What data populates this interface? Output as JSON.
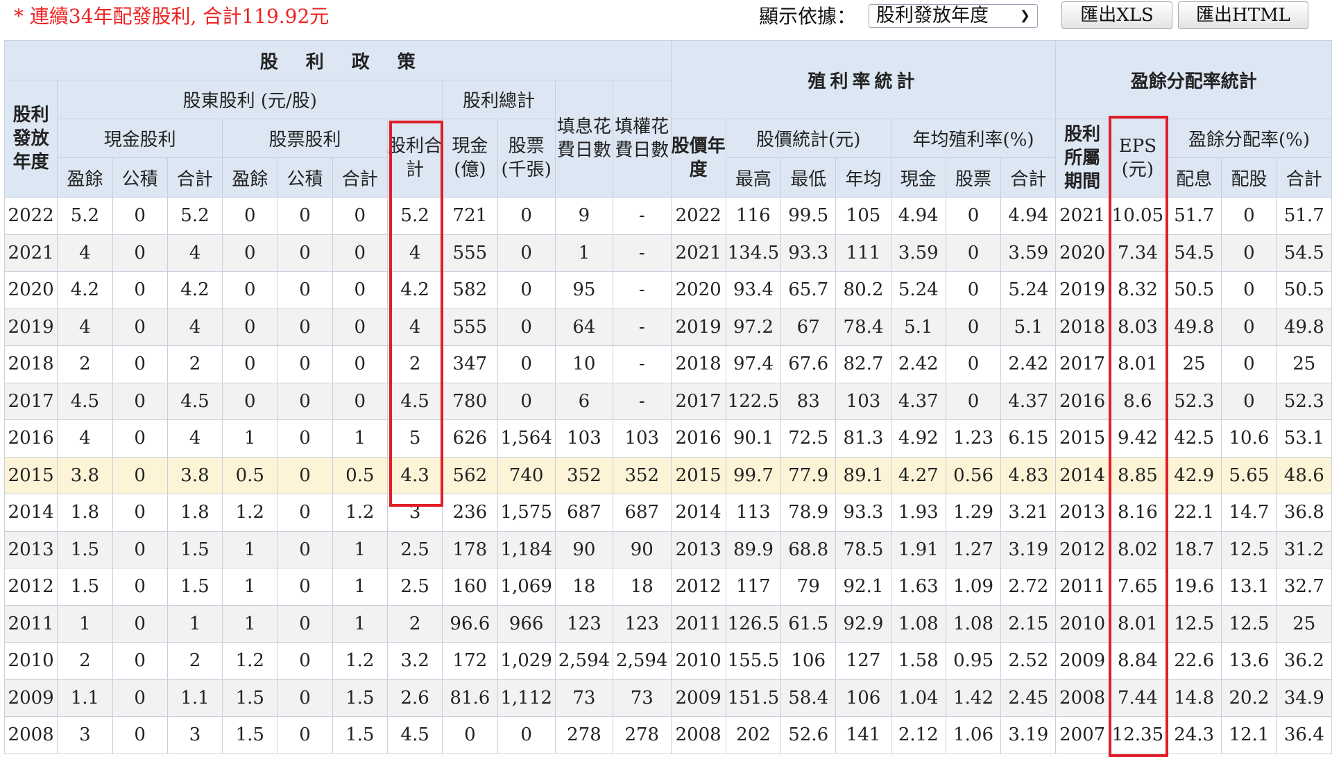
{
  "topbar": {
    "note": "* 連續34年配發股利, 合計119.92元",
    "display_label": "顯示依據：",
    "display_select": "股利發放年度",
    "export_xls": "匯出XLS",
    "export_html": "匯出HTML"
  },
  "header": {
    "policy": "股利政策",
    "yield_stats": "殖利率統計",
    "payout_stats": "盈餘分配率統計",
    "dividend_year": "股利發放年度",
    "shareholder_dividend": "股東股利 (元/股)",
    "dividend_total_group": "股利總計",
    "ex_div_days": "填息花費日數",
    "ex_right_days": "填權花費日數",
    "cash_dividend": "現金股利",
    "stock_dividend": "股票股利",
    "dividend_sum": "股利合計",
    "cash_total": "現金(億)",
    "stock_total": "股票(千張)",
    "earnings": "盈餘",
    "reserve": "公積",
    "subtotal": "合計",
    "price_year": "股價年度",
    "price_stats": "股價統計(元)",
    "avg_yield": "年均殖利率(%)",
    "high": "最高",
    "low": "最低",
    "avg": "年均",
    "cash": "現金",
    "stock": "股票",
    "period": "股利所屬期間",
    "eps": "EPS (元)",
    "payout_ratio": "盈餘分配率(%)",
    "payout_cash": "配息",
    "payout_stock": "配股"
  },
  "rows": [
    [
      "2022",
      "5.2",
      "0",
      "5.2",
      "0",
      "0",
      "0",
      "5.2",
      "721",
      "0",
      "9",
      "-",
      "2022",
      "116",
      "99.5",
      "105",
      "4.94",
      "0",
      "4.94",
      "2021",
      "10.05",
      "51.7",
      "0",
      "51.7"
    ],
    [
      "2021",
      "4",
      "0",
      "4",
      "0",
      "0",
      "0",
      "4",
      "555",
      "0",
      "1",
      "-",
      "2021",
      "134.5",
      "93.3",
      "111",
      "3.59",
      "0",
      "3.59",
      "2020",
      "7.34",
      "54.5",
      "0",
      "54.5"
    ],
    [
      "2020",
      "4.2",
      "0",
      "4.2",
      "0",
      "0",
      "0",
      "4.2",
      "582",
      "0",
      "95",
      "-",
      "2020",
      "93.4",
      "65.7",
      "80.2",
      "5.24",
      "0",
      "5.24",
      "2019",
      "8.32",
      "50.5",
      "0",
      "50.5"
    ],
    [
      "2019",
      "4",
      "0",
      "4",
      "0",
      "0",
      "0",
      "4",
      "555",
      "0",
      "64",
      "-",
      "2019",
      "97.2",
      "67",
      "78.4",
      "5.1",
      "0",
      "5.1",
      "2018",
      "8.03",
      "49.8",
      "0",
      "49.8"
    ],
    [
      "2018",
      "2",
      "0",
      "2",
      "0",
      "0",
      "0",
      "2",
      "347",
      "0",
      "10",
      "-",
      "2018",
      "97.4",
      "67.6",
      "82.7",
      "2.42",
      "0",
      "2.42",
      "2017",
      "8.01",
      "25",
      "0",
      "25"
    ],
    [
      "2017",
      "4.5",
      "0",
      "4.5",
      "0",
      "0",
      "0",
      "4.5",
      "780",
      "0",
      "6",
      "-",
      "2017",
      "122.5",
      "83",
      "103",
      "4.37",
      "0",
      "4.37",
      "2016",
      "8.6",
      "52.3",
      "0",
      "52.3"
    ],
    [
      "2016",
      "4",
      "0",
      "4",
      "1",
      "0",
      "1",
      "5",
      "626",
      "1,564",
      "103",
      "103",
      "2016",
      "90.1",
      "72.5",
      "81.3",
      "4.92",
      "1.23",
      "6.15",
      "2015",
      "9.42",
      "42.5",
      "10.6",
      "53.1"
    ],
    [
      "2015",
      "3.8",
      "0",
      "3.8",
      "0.5",
      "0",
      "0.5",
      "4.3",
      "562",
      "740",
      "352",
      "352",
      "2015",
      "99.7",
      "77.9",
      "89.1",
      "4.27",
      "0.56",
      "4.83",
      "2014",
      "8.85",
      "42.9",
      "5.65",
      "48.6"
    ],
    [
      "2014",
      "1.8",
      "0",
      "1.8",
      "1.2",
      "0",
      "1.2",
      "3",
      "236",
      "1,575",
      "687",
      "687",
      "2014",
      "113",
      "78.9",
      "93.3",
      "1.93",
      "1.29",
      "3.21",
      "2013",
      "8.16",
      "22.1",
      "14.7",
      "36.8"
    ],
    [
      "2013",
      "1.5",
      "0",
      "1.5",
      "1",
      "0",
      "1",
      "2.5",
      "178",
      "1,184",
      "90",
      "90",
      "2013",
      "89.9",
      "68.8",
      "78.5",
      "1.91",
      "1.27",
      "3.19",
      "2012",
      "8.02",
      "18.7",
      "12.5",
      "31.2"
    ],
    [
      "2012",
      "1.5",
      "0",
      "1.5",
      "1",
      "0",
      "1",
      "2.5",
      "160",
      "1,069",
      "18",
      "18",
      "2012",
      "117",
      "79",
      "92.1",
      "1.63",
      "1.09",
      "2.72",
      "2011",
      "7.65",
      "19.6",
      "13.1",
      "32.7"
    ],
    [
      "2011",
      "1",
      "0",
      "1",
      "1",
      "0",
      "1",
      "2",
      "96.6",
      "966",
      "123",
      "123",
      "2011",
      "126.5",
      "61.5",
      "92.9",
      "1.08",
      "1.08",
      "2.15",
      "2010",
      "8.01",
      "12.5",
      "12.5",
      "25"
    ],
    [
      "2010",
      "2",
      "0",
      "2",
      "1.2",
      "0",
      "1.2",
      "3.2",
      "172",
      "1,029",
      "2,594",
      "2,594",
      "2010",
      "155.5",
      "106",
      "127",
      "1.58",
      "0.95",
      "2.52",
      "2009",
      "8.84",
      "22.6",
      "13.6",
      "36.2"
    ],
    [
      "2009",
      "1.1",
      "0",
      "1.1",
      "1.5",
      "0",
      "1.5",
      "2.6",
      "81.6",
      "1,112",
      "73",
      "73",
      "2009",
      "151.5",
      "58.4",
      "106",
      "1.04",
      "1.42",
      "2.45",
      "2008",
      "7.44",
      "14.8",
      "20.2",
      "34.9"
    ],
    [
      "2008",
      "3",
      "0",
      "3",
      "1.5",
      "0",
      "1.5",
      "4.5",
      "0",
      "0",
      "278",
      "278",
      "2008",
      "202",
      "52.6",
      "141",
      "2.12",
      "1.06",
      "3.19",
      "2007",
      "12.35",
      "24.3",
      "12.1",
      "36.4"
    ]
  ],
  "highlight_row": "2015",
  "colors": {
    "header_bg": "#dde7f3",
    "highlight": "#fdf4d8",
    "red_box": "#e01e28",
    "note": "#ee2222"
  }
}
